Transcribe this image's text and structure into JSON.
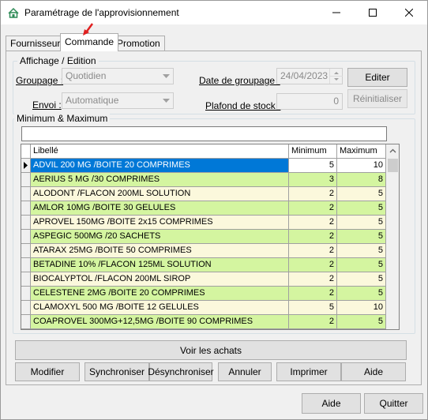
{
  "window": {
    "title": "Paramétrage de l'approvisionnement"
  },
  "tabs": [
    {
      "label": "Fournisseur"
    },
    {
      "label": "Commande"
    },
    {
      "label": "Promotion"
    }
  ],
  "affichage": {
    "legend": "Affichage / Edition",
    "groupage_label": "Groupage :",
    "groupage_value": "Quotidien",
    "envoi_label": "Envoi :",
    "envoi_value": "Automatique",
    "date_label": "Date de groupage :",
    "date_value": "24/04/2023",
    "plafond_label": "Plafond de stock :",
    "plafond_value": "0",
    "editer_label": "Editer",
    "reinit_label": "Réinitialiser"
  },
  "minmax": {
    "legend": "Minimum & Maximum",
    "search_value": "",
    "columns": [
      "Libellé",
      "Minimum",
      "Maximum"
    ],
    "rows": [
      {
        "libelle": "ADVIL 200 MG /BOITE 20 COMPRIMES",
        "min": "5",
        "max": "10"
      },
      {
        "libelle": "AERIUS 5 MG /30 COMPRIMES",
        "min": "3",
        "max": "8"
      },
      {
        "libelle": "ALODONT /FLACON 200ML SOLUTION",
        "min": "2",
        "max": "5"
      },
      {
        "libelle": "AMLOR 10MG /BOITE 30 GELULES",
        "min": "2",
        "max": "5"
      },
      {
        "libelle": "APROVEL 150MG /BOITE 2x15 COMPRIMES",
        "min": "2",
        "max": "5"
      },
      {
        "libelle": "ASPEGIC 500MG /20 SACHETS",
        "min": "2",
        "max": "5"
      },
      {
        "libelle": "ATARAX 25MG /BOITE 50 COMPRIMES",
        "min": "2",
        "max": "5"
      },
      {
        "libelle": "BETADINE 10% /FLACON 125ML SOLUTION",
        "min": "2",
        "max": "5"
      },
      {
        "libelle": "BIOCALYPTOL /FLACON 200ML SIROP",
        "min": "2",
        "max": "5"
      },
      {
        "libelle": "CELESTENE 2MG /BOITE 20 COMPRIMES",
        "min": "2",
        "max": "5"
      },
      {
        "libelle": "CLAMOXYL 500 MG /BOITE 12 GELULES",
        "min": "5",
        "max": "10"
      },
      {
        "libelle": "COAPROVEL 300MG+12,5MG /BOITE 90 COMPRIMES",
        "min": "2",
        "max": "5"
      },
      {
        "libelle": "",
        "min": "",
        "max": ""
      }
    ]
  },
  "buttons": {
    "voir_achats": "Voir les achats",
    "modifier": "Modifier",
    "synchroniser": "Synchroniser",
    "desynchroniser": "Désynchroniser",
    "annuler": "Annuler",
    "imprimer": "Imprimer",
    "aide_inner": "Aide",
    "aide": "Aide",
    "quitter": "Quitter"
  },
  "colors": {
    "row_green": "#d4f5a0",
    "row_cream": "#fbf8dc",
    "selection": "#0078d7",
    "red_arrow": "#e02020"
  }
}
